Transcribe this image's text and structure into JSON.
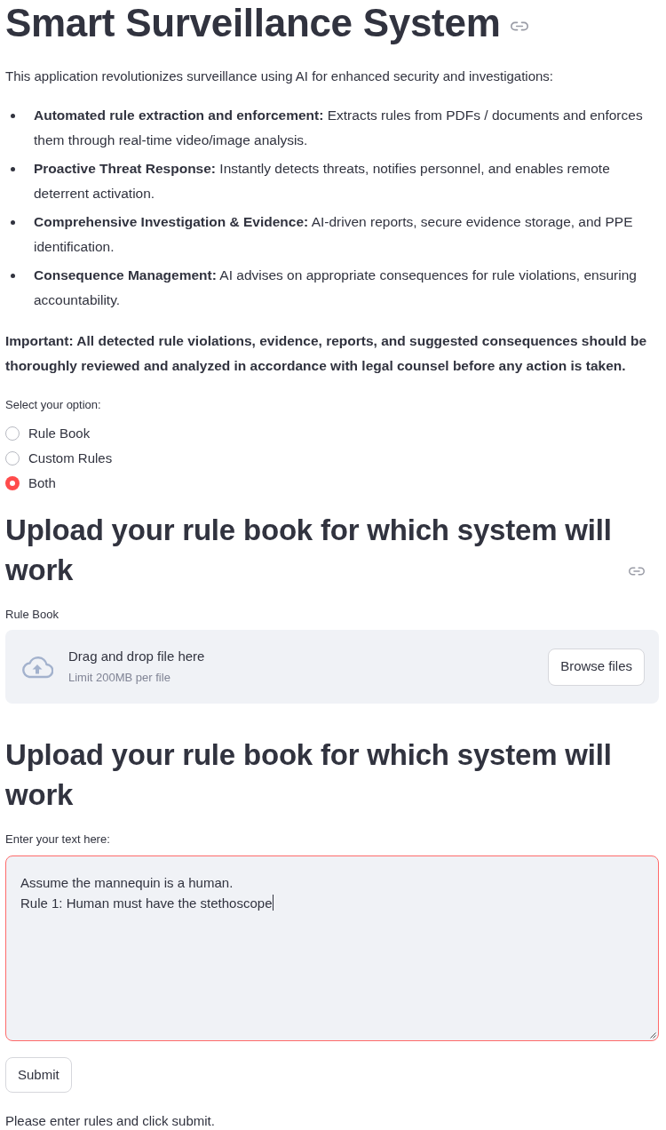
{
  "header": {
    "title": "Smart Surveillance System",
    "show_link": true
  },
  "intro": "This application revolutionizes surveillance using AI for enhanced security and investigations:",
  "features": [
    "**Automated rule extraction and enforcement:** Extracts rules from PDFs / documents and enforces them through real-time video/image analysis.",
    "**Proactive Threat Response:** Instantly detects threats, notifies personnel, and enables remote deterrent activation.",
    "**Comprehensive Investigation & Evidence:** AI-driven reports, secure evidence storage, and PPE identification.",
    "**Consequence Management:** AI advises on appropriate consequences for rule violations, ensuring accountability."
  ],
  "notice": "Important: All detected rule violations, evidence, reports, and suggested consequences should be thoroughly reviewed and analyzed in accordance with legal counsel before any action is taken.",
  "option_group": {
    "label": "Select your option:",
    "options": [
      {
        "label": "Rule Book",
        "selected": false
      },
      {
        "label": "Custom Rules",
        "selected": false
      },
      {
        "label": "Both",
        "selected": true
      }
    ]
  },
  "upload_section": {
    "heading": "Upload your rule book for which system will work",
    "show_link": true,
    "uploader": {
      "label": "Rule Book",
      "instruction": "Drag and drop file here",
      "limit": "Limit 200MB per file",
      "button": "Browse files"
    }
  },
  "rules_section": {
    "heading": "Upload your rule book for which system will work",
    "text_area": {
      "label": "Enter your text here:",
      "value": "Assume the mannequin is a human.\nRule 1: Human must have the stethoscope",
      "focused": true
    },
    "button": "Submit"
  },
  "status_message": "Please enter rules and click submit."
}
